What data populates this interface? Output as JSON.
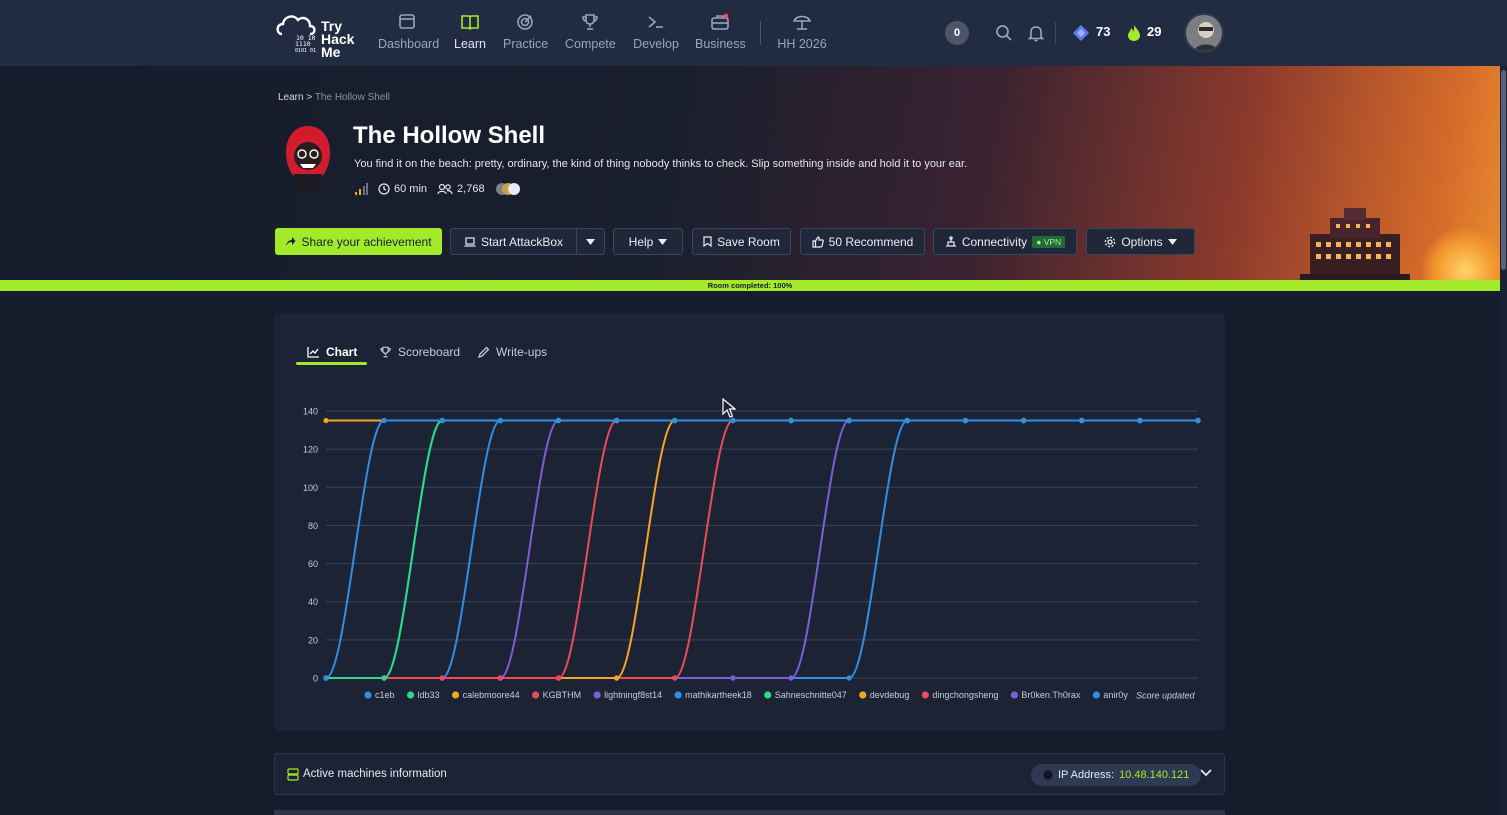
{
  "nav": {
    "logo_text": "Try\nHack\nMe",
    "items": [
      {
        "label": "Dashboard",
        "icon": "dashboard-icon"
      },
      {
        "label": "Learn",
        "icon": "book-icon"
      },
      {
        "label": "Practice",
        "icon": "target-icon"
      },
      {
        "label": "Compete",
        "icon": "trophy-icon"
      },
      {
        "label": "Develop",
        "icon": "terminal-icon"
      },
      {
        "label": "Business",
        "icon": "briefcase-icon"
      },
      {
        "label": "HH 2026",
        "icon": "beach-umbrella-icon"
      }
    ],
    "active": "Learn",
    "notification_count": "0",
    "gems": "73",
    "streak": "29"
  },
  "breadcrumb": {
    "root": "Learn",
    "separator": ">",
    "current": "The Hollow Shell"
  },
  "room": {
    "title": "The Hollow Shell",
    "description": "You find it on the beach: pretty, ordinary, the kind of thing nobody thinks to check. Slip something inside and hold it to your ear.",
    "duration": "60 min",
    "users": "2,768"
  },
  "buttons": {
    "share": "Share your achievement",
    "attackbox": "Start AttackBox",
    "help": "Help",
    "save": "Save Room",
    "recommend": "50 Recommend",
    "connectivity": "Connectivity",
    "vpn": "VPN",
    "options": "Options"
  },
  "progress": {
    "label": "Room completed: 100%",
    "value": 100
  },
  "tabs": [
    {
      "label": "Chart",
      "icon": "line-chart-icon"
    },
    {
      "label": "Scoreboard",
      "icon": "trophy-icon"
    },
    {
      "label": "Write-ups",
      "icon": "pencil-icon"
    }
  ],
  "chart_data": {
    "type": "line",
    "ylim": [
      0,
      140
    ],
    "yticks": [
      0,
      20,
      40,
      60,
      80,
      100,
      120,
      140
    ],
    "score_updated_label": "Score updated",
    "grid": true,
    "legend_position": "bottom",
    "series": [
      {
        "name": "c1eb",
        "color": "#2f8fe6",
        "values": [
          0,
          135,
          135,
          135,
          135,
          135,
          135,
          135,
          135,
          135,
          135,
          135,
          135,
          135,
          135,
          135
        ]
      },
      {
        "name": "ldb33",
        "color": "#2fd88a",
        "values": [
          0,
          0,
          135,
          135,
          135,
          135,
          135,
          135,
          135,
          135,
          135,
          135,
          135,
          135,
          135,
          135
        ]
      },
      {
        "name": "calebmoore44",
        "color": "#f5a623",
        "values": [
          135,
          135,
          135,
          135,
          135,
          135,
          135,
          135,
          135,
          135,
          135,
          135,
          135,
          135,
          135,
          135
        ]
      },
      {
        "name": "KGBTHM",
        "color": "#ec4b5a",
        "values": [
          0,
          0,
          0,
          0,
          0,
          135,
          135,
          135,
          135,
          135,
          135,
          135,
          135,
          135,
          135,
          135
        ]
      },
      {
        "name": "lightningf8st14",
        "color": "#7c5fd6",
        "values": [
          0,
          0,
          0,
          0,
          135,
          135,
          135,
          135,
          135,
          135,
          135,
          135,
          135,
          135,
          135,
          135
        ]
      },
      {
        "name": "mathikartheek18",
        "color": "#2f8fe6",
        "values": [
          0,
          0,
          0,
          135,
          135,
          135,
          135,
          135,
          135,
          135,
          135,
          135,
          135,
          135,
          135,
          135
        ]
      },
      {
        "name": "Sahneschnitte047",
        "color": "#2fd88a",
        "values": [
          0,
          0,
          135,
          135,
          135,
          135,
          135,
          135,
          135,
          135,
          135,
          135,
          135,
          135,
          135,
          135
        ]
      },
      {
        "name": "devdebug",
        "color": "#f5a623",
        "values": [
          0,
          0,
          0,
          0,
          0,
          0,
          135,
          135,
          135,
          135,
          135,
          135,
          135,
          135,
          135,
          135
        ]
      },
      {
        "name": "dingchongsheng",
        "color": "#ec4b5a",
        "values": [
          0,
          0,
          0,
          0,
          0,
          0,
          0,
          135,
          135,
          135,
          135,
          135,
          135,
          135,
          135,
          135
        ]
      },
      {
        "name": "Br0ken.Th0rax",
        "color": "#7c5fd6",
        "values": [
          0,
          0,
          0,
          0,
          0,
          0,
          0,
          0,
          0,
          135,
          135,
          135,
          135,
          135,
          135,
          135
        ]
      },
      {
        "name": "anir0y",
        "color": "#2f8fe6",
        "values": [
          0,
          0,
          0,
          0,
          0,
          0,
          0,
          0,
          0,
          0,
          135,
          135,
          135,
          135,
          135,
          135
        ]
      }
    ]
  },
  "machines": {
    "label": "Active machines information",
    "ip_label": "IP Address:",
    "ip": "10.48.140.121"
  }
}
